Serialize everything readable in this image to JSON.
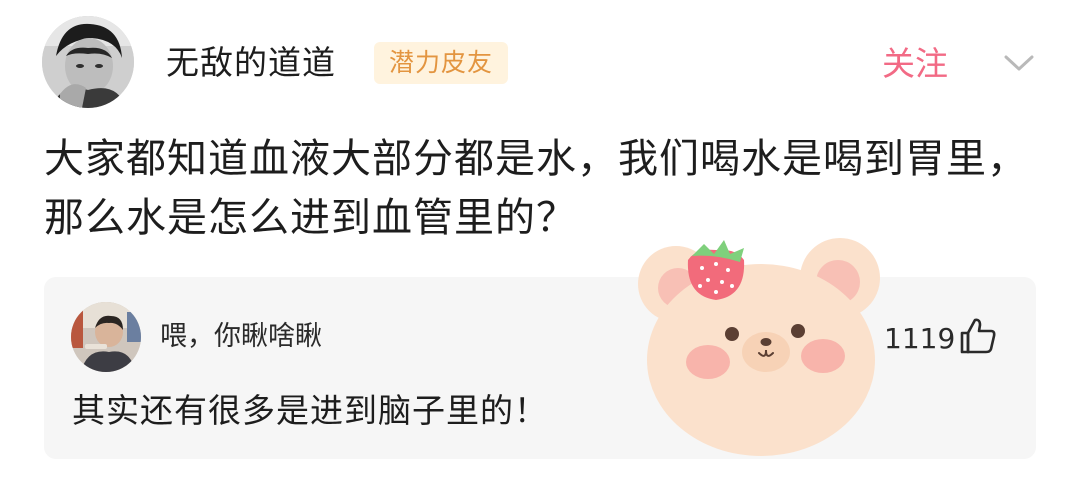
{
  "post": {
    "username": "无敌的道道",
    "badge": "潜力皮友",
    "follow_label": "关注",
    "question": "大家都知道血液大部分都是水，我们喝水是喝到胃里，那么水是怎么进到血管里的？"
  },
  "top_comment": {
    "username": "喂，你瞅啥瞅",
    "text": "其实还有很多是进到脑子里的！",
    "likes": "1119"
  },
  "icons": {
    "chevron": "chevron-down-icon",
    "like": "thumbs-up-icon",
    "sticker": "bear-with-strawberry-sticker"
  },
  "colors": {
    "follow": "#f26a85",
    "badge_text": "#e39540",
    "badge_bg": "#fff3de",
    "card_bg": "#f6f6f6"
  }
}
